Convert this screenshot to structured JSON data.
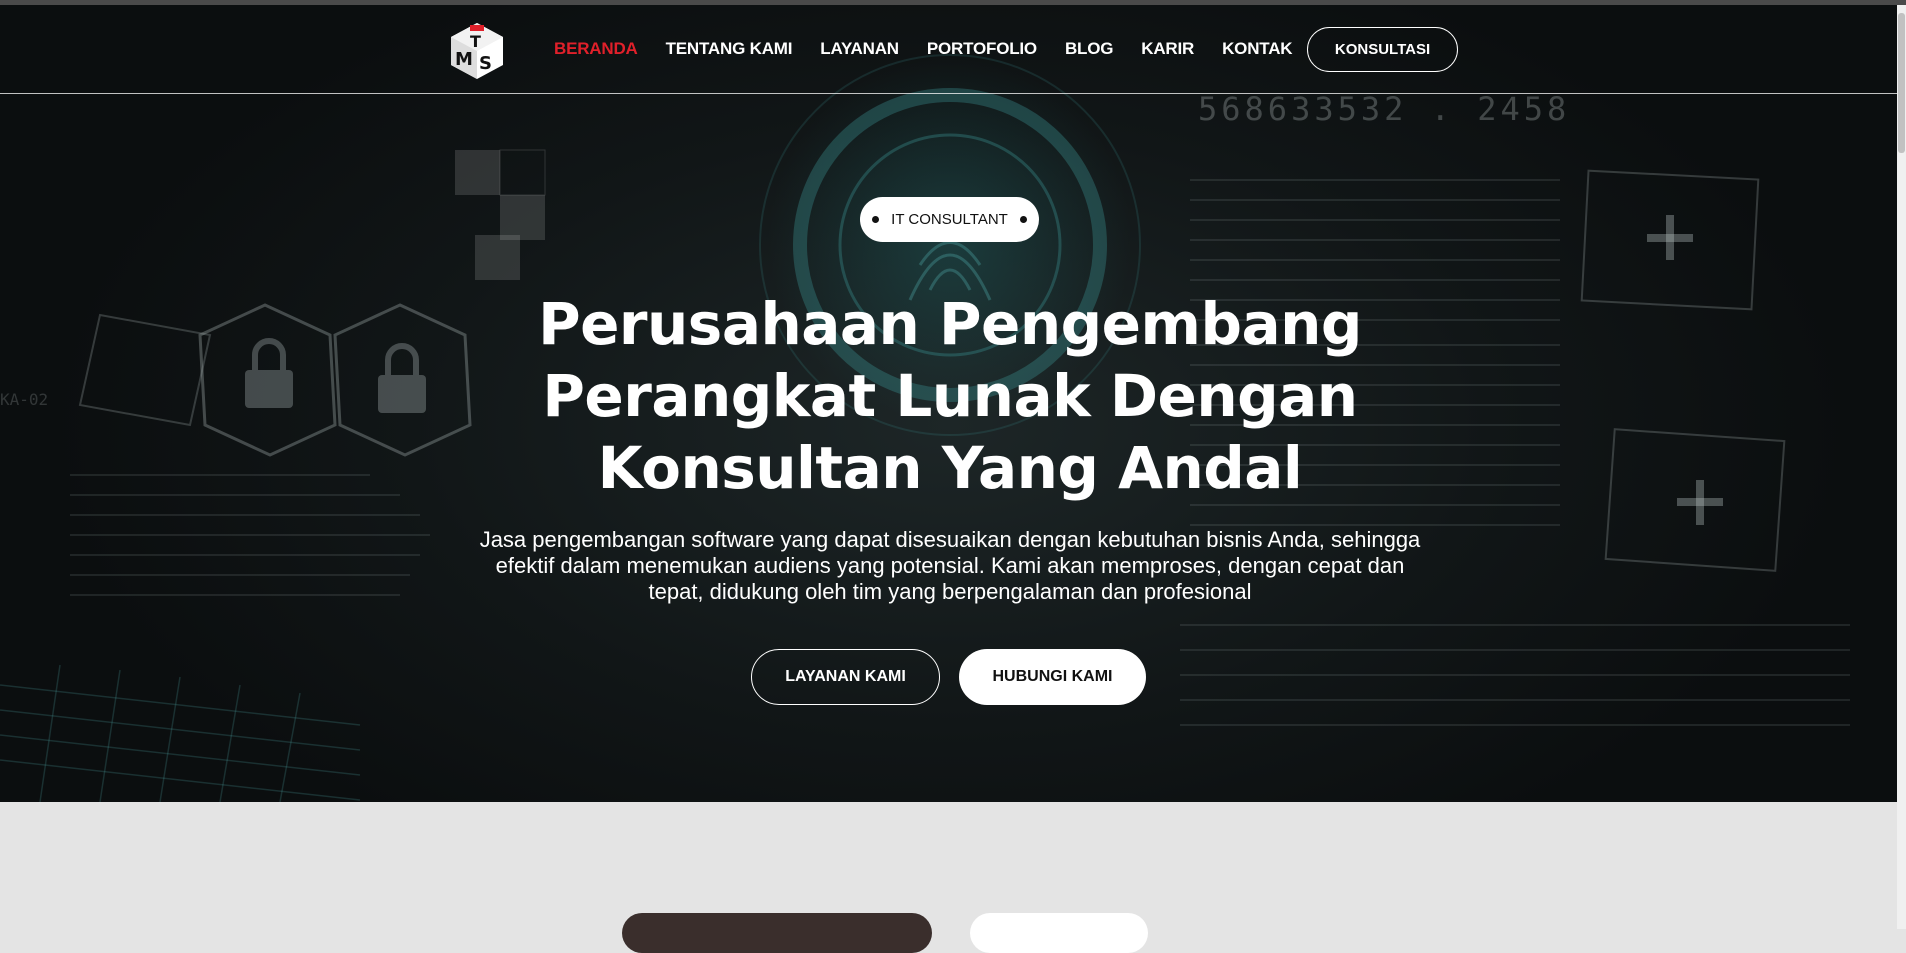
{
  "colors": {
    "accent": "#e0202a",
    "hero_bg": "#111617",
    "page_bg": "#e4e4e4"
  },
  "nav": {
    "logo_icon": "mts-cube-logo-icon",
    "items": [
      {
        "label": "BERANDA",
        "active": true
      },
      {
        "label": "TENTANG KAMI"
      },
      {
        "label": "LAYANAN"
      },
      {
        "label": "PORTOFOLIO"
      },
      {
        "label": "BLOG"
      },
      {
        "label": "KARIR"
      },
      {
        "label": "KONTAK"
      }
    ],
    "cta_label": "KONSULTASI"
  },
  "hero": {
    "badge": "IT CONSULTANT",
    "headline_lines": [
      "Perusahaan Pengembang",
      "Perangkat Lunak Dengan",
      "Konsultan Yang Andal"
    ],
    "subtext_lines": [
      "Jasa pengembangan software yang dapat disesuaikan dengan kebutuhan bisnis Anda, sehingga",
      "efektif dalam menemukan audiens yang potensial. Kami akan memproses, dengan cepat dan",
      "tepat, didukung oleh tim yang berpengalaman dan profesional"
    ],
    "primary_button": "LAYANAN KAMI",
    "secondary_button": "HUBUNGI KAMI",
    "background_icons": [
      "fingerprint-icon",
      "padlock-icon",
      "padlock-icon",
      "plus-icon",
      "plus-icon"
    ],
    "background_text": [
      "568633532 . 2458",
      "KA-02"
    ]
  }
}
